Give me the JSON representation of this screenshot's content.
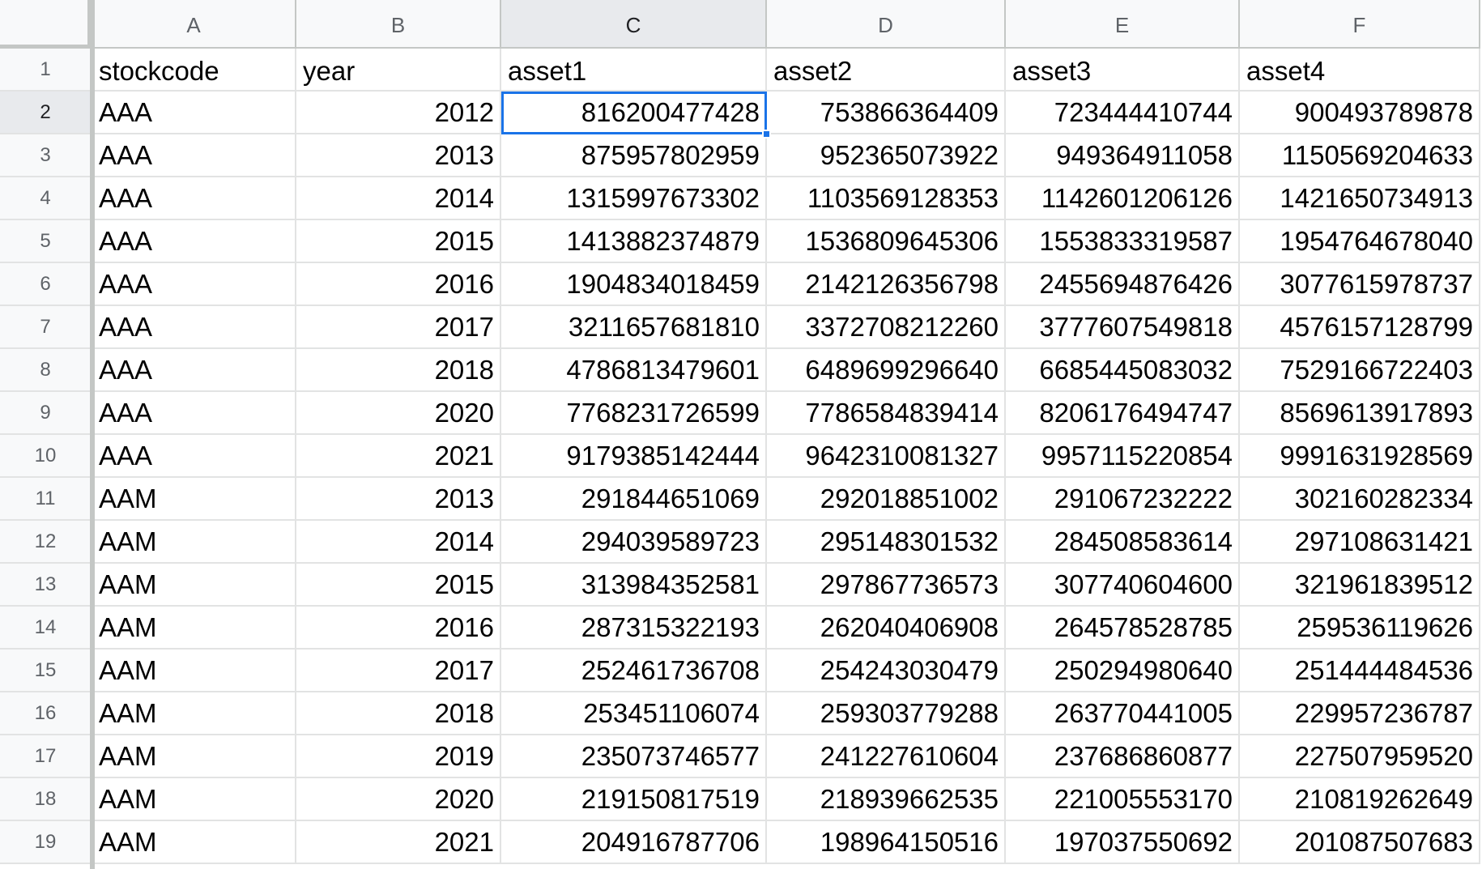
{
  "columns": [
    "A",
    "B",
    "C",
    "D",
    "E",
    "F"
  ],
  "active_column": "C",
  "active_row": 2,
  "selected_cell": "C2",
  "rows": [
    {
      "n": "1",
      "cells": [
        "stockcode",
        "year",
        "asset1",
        "asset2",
        "asset3",
        "asset4"
      ]
    },
    {
      "n": "2",
      "cells": [
        "AAA",
        "2012",
        "816200477428",
        "753866364409",
        "723444410744",
        "900493789878"
      ]
    },
    {
      "n": "3",
      "cells": [
        "AAA",
        "2013",
        "875957802959",
        "952365073922",
        "949364911058",
        "1150569204633"
      ]
    },
    {
      "n": "4",
      "cells": [
        "AAA",
        "2014",
        "1315997673302",
        "1103569128353",
        "1142601206126",
        "1421650734913"
      ]
    },
    {
      "n": "5",
      "cells": [
        "AAA",
        "2015",
        "1413882374879",
        "1536809645306",
        "1553833319587",
        "1954764678040"
      ]
    },
    {
      "n": "6",
      "cells": [
        "AAA",
        "2016",
        "1904834018459",
        "2142126356798",
        "2455694876426",
        "3077615978737"
      ]
    },
    {
      "n": "7",
      "cells": [
        "AAA",
        "2017",
        "3211657681810",
        "3372708212260",
        "3777607549818",
        "4576157128799"
      ]
    },
    {
      "n": "8",
      "cells": [
        "AAA",
        "2018",
        "4786813479601",
        "6489699296640",
        "6685445083032",
        "7529166722403"
      ]
    },
    {
      "n": "9",
      "cells": [
        "AAA",
        "2020",
        "7768231726599",
        "7786584839414",
        "8206176494747",
        "8569613917893"
      ]
    },
    {
      "n": "10",
      "cells": [
        "AAA",
        "2021",
        "9179385142444",
        "9642310081327",
        "9957115220854",
        "9991631928569"
      ]
    },
    {
      "n": "11",
      "cells": [
        "AAM",
        "2013",
        "291844651069",
        "292018851002",
        "291067232222",
        "302160282334"
      ]
    },
    {
      "n": "12",
      "cells": [
        "AAM",
        "2014",
        "294039589723",
        "295148301532",
        "284508583614",
        "297108631421"
      ]
    },
    {
      "n": "13",
      "cells": [
        "AAM",
        "2015",
        "313984352581",
        "297867736573",
        "307740604600",
        "321961839512"
      ]
    },
    {
      "n": "14",
      "cells": [
        "AAM",
        "2016",
        "287315322193",
        "262040406908",
        "264578528785",
        "259536119626"
      ]
    },
    {
      "n": "15",
      "cells": [
        "AAM",
        "2017",
        "252461736708",
        "254243030479",
        "250294980640",
        "251444484536"
      ]
    },
    {
      "n": "16",
      "cells": [
        "AAM",
        "2018",
        "253451106074",
        "259303779288",
        "263770441005",
        "229957236787"
      ]
    },
    {
      "n": "17",
      "cells": [
        "AAM",
        "2019",
        "235073746577",
        "241227610604",
        "237686860877",
        "227507959520"
      ]
    },
    {
      "n": "18",
      "cells": [
        "AAM",
        "2020",
        "219150817519",
        "218939662535",
        "221005553170",
        "210819262649"
      ]
    },
    {
      "n": "19",
      "cells": [
        "AAM",
        "2021",
        "204916787706",
        "198964150516",
        "197037550692",
        "201087507683"
      ]
    }
  ]
}
